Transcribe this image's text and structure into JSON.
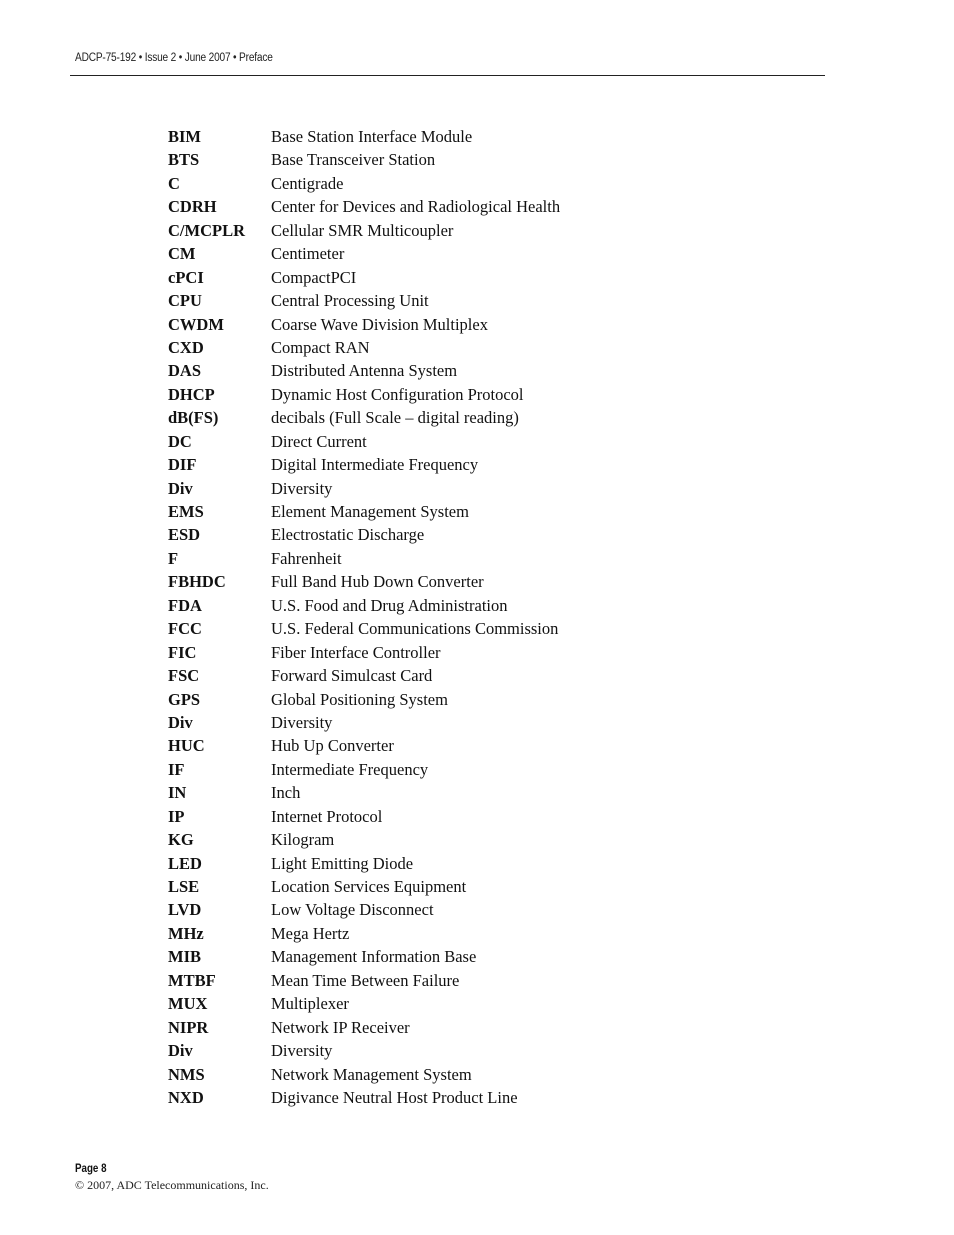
{
  "header": {
    "running_title": "ADCP-75-192 • Issue 2 • June 2007 • Preface"
  },
  "glossary": {
    "entries": [
      {
        "term": "BIM",
        "definition": "Base Station Interface Module"
      },
      {
        "term": "BTS",
        "definition": "Base Transceiver Station"
      },
      {
        "term": "C",
        "definition": "Centigrade"
      },
      {
        "term": "CDRH",
        "definition": "Center for Devices and Radiological Health"
      },
      {
        "term": "C/MCPLR",
        "definition": "Cellular SMR Multicoupler"
      },
      {
        "term": "CM",
        "definition": "Centimeter"
      },
      {
        "term": "cPCI",
        "definition": "CompactPCI"
      },
      {
        "term": "CPU",
        "definition": "Central Processing Unit"
      },
      {
        "term": "CWDM",
        "definition": "Coarse Wave Division Multiplex"
      },
      {
        "term": "CXD",
        "definition": "Compact RAN"
      },
      {
        "term": "DAS",
        "definition": "Distributed Antenna System"
      },
      {
        "term": "DHCP",
        "definition": "Dynamic Host Configuration Protocol"
      },
      {
        "term": "dB(FS)",
        "definition": "decibals (Full Scale – digital reading)"
      },
      {
        "term": "DC",
        "definition": "Direct Current"
      },
      {
        "term": "DIF",
        "definition": "Digital Intermediate Frequency"
      },
      {
        "term": "Div",
        "definition": "Diversity"
      },
      {
        "term": "EMS",
        "definition": "Element Management System"
      },
      {
        "term": "ESD",
        "definition": "Electrostatic Discharge"
      },
      {
        "term": "F",
        "definition": "Fahrenheit"
      },
      {
        "term": "FBHDC",
        "definition": "Full Band Hub Down Converter"
      },
      {
        "term": "FDA",
        "definition": "U.S. Food and Drug Administration"
      },
      {
        "term": "FCC",
        "definition": "U.S. Federal Communications Commission"
      },
      {
        "term": "FIC",
        "definition": "Fiber Interface Controller"
      },
      {
        "term": "FSC",
        "definition": "Forward Simulcast Card"
      },
      {
        "term": "GPS",
        "definition": "Global Positioning System"
      },
      {
        "term": "Div",
        "definition": "Diversity"
      },
      {
        "term": "HUC",
        "definition": "Hub Up Converter"
      },
      {
        "term": "IF",
        "definition": "Intermediate Frequency"
      },
      {
        "term": "IN",
        "definition": "Inch"
      },
      {
        "term": "IP",
        "definition": "Internet Protocol"
      },
      {
        "term": "KG",
        "definition": "Kilogram"
      },
      {
        "term": "LED",
        "definition": "Light Emitting Diode"
      },
      {
        "term": "LSE",
        "definition": "Location Services Equipment"
      },
      {
        "term": "LVD",
        "definition": "Low Voltage Disconnect"
      },
      {
        "term": "MHz",
        "definition": "Mega Hertz"
      },
      {
        "term": "MIB",
        "definition": "Management Information Base"
      },
      {
        "term": "MTBF",
        "definition": "Mean Time Between Failure"
      },
      {
        "term": "MUX",
        "definition": "Multiplexer"
      },
      {
        "term": "NIPR",
        "definition": "Network IP Receiver"
      },
      {
        "term": "Div",
        "definition": "Diversity"
      },
      {
        "term": "NMS",
        "definition": "Network Management System"
      },
      {
        "term": "NXD",
        "definition": "Digivance Neutral Host Product Line"
      }
    ]
  },
  "footer": {
    "page_label": "Page 8",
    "copyright": "© 2007, ADC Telecommunications, Inc."
  }
}
